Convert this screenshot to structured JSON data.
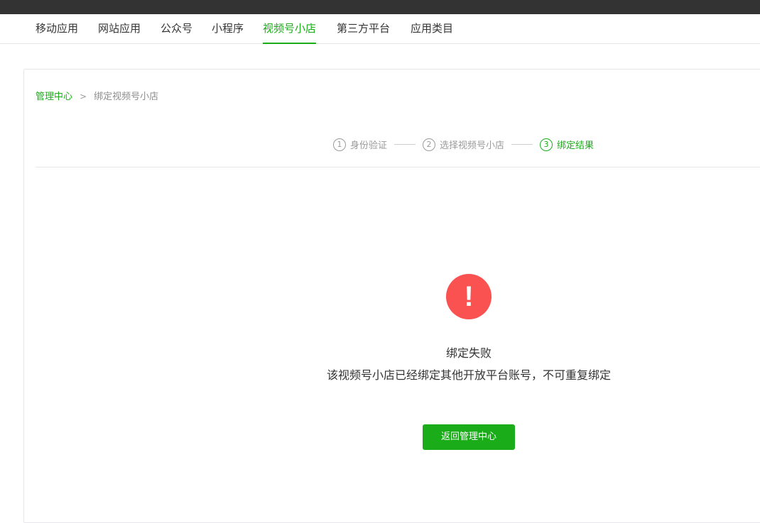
{
  "nav": {
    "items": [
      {
        "label": "移动应用"
      },
      {
        "label": "网站应用"
      },
      {
        "label": "公众号"
      },
      {
        "label": "小程序"
      },
      {
        "label": "视频号小店"
      },
      {
        "label": "第三方平台"
      },
      {
        "label": "应用类目"
      }
    ],
    "active_index": 4
  },
  "breadcrumb": {
    "home": "管理中心",
    "separator": ">",
    "current": "绑定视频号小店"
  },
  "steps": [
    {
      "num": "1",
      "label": "身份验证"
    },
    {
      "num": "2",
      "label": "选择视频号小店"
    },
    {
      "num": "3",
      "label": "绑定结果"
    }
  ],
  "result": {
    "icon": "!",
    "title": "绑定失败",
    "description": "该视频号小店已经绑定其他开放平台账号，不可重复绑定",
    "button_label": "返回管理中心"
  },
  "colors": {
    "accent": "#1aad19",
    "error": "#fa5151",
    "topbar": "#333333"
  }
}
